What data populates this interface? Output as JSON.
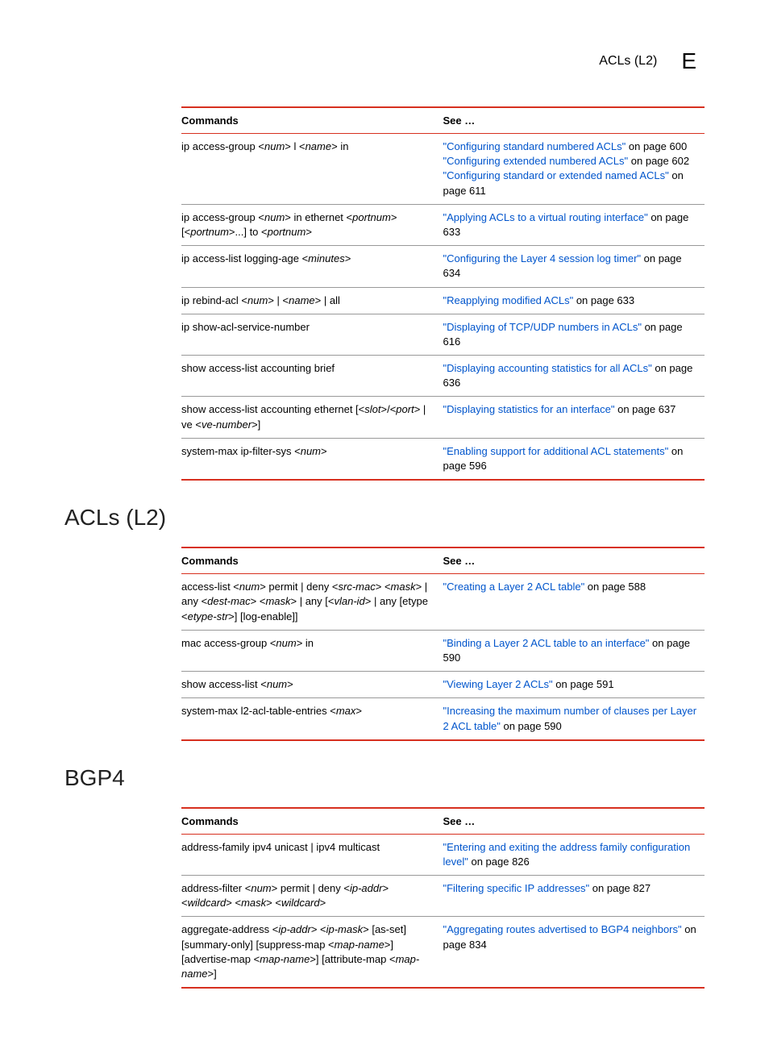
{
  "header": {
    "label": "ACLs (L2)",
    "letter": "E"
  },
  "table1": {
    "col1": "Commands",
    "col2": "See …",
    "rows": [
      {
        "cmd_parts": [
          "ip access-group <",
          "num",
          "> l <",
          "name",
          "> in"
        ],
        "see": [
          {
            "link": "\"Configuring standard numbered ACLs\"",
            "tail": " on page 600"
          },
          {
            "link": "\"Configuring extended numbered ACLs\"",
            "tail": " on page 602"
          },
          {
            "link": "\"Configuring standard or extended named ACLs\"",
            "tail": " on page 611"
          }
        ]
      },
      {
        "cmd_parts": [
          "ip access-group <",
          "num",
          "> in ethernet <",
          "portnum",
          "> [<",
          "portnum",
          ">...] to <",
          "portnum",
          ">"
        ],
        "see": [
          {
            "link": "\"Applying ACLs to a virtual routing interface\"",
            "tail": " on page 633"
          }
        ]
      },
      {
        "cmd_parts": [
          "ip access-list logging-age <",
          "minutes",
          ">"
        ],
        "see": [
          {
            "link": "\"Configuring the Layer 4 session log timer\"",
            "tail": " on page 634"
          }
        ]
      },
      {
        "cmd_parts": [
          "ip rebind-acl <",
          "num",
          "> | <",
          "name",
          "> | all"
        ],
        "see": [
          {
            "link": "\"Reapplying modified ACLs\"",
            "tail": " on page 633"
          }
        ]
      },
      {
        "cmd_parts": [
          "ip show-acl-service-number"
        ],
        "see": [
          {
            "link": "\"Displaying of TCP/UDP numbers in ACLs\"",
            "tail": " on page 616"
          }
        ]
      },
      {
        "cmd_parts": [
          "show access-list accounting brief"
        ],
        "see": [
          {
            "link": "\"Displaying accounting statistics for all ACLs\"",
            "tail": " on page 636"
          }
        ]
      },
      {
        "cmd_parts": [
          "show access-list accounting ethernet [<",
          "slot",
          ">/<",
          "port",
          "> | ve <",
          "ve-number",
          ">]"
        ],
        "see": [
          {
            "link": "\"Displaying statistics for an interface\"",
            "tail": " on page 637"
          }
        ]
      },
      {
        "cmd_parts": [
          "system-max ip-filter-sys <",
          "num",
          ">"
        ],
        "see": [
          {
            "link": "\"Enabling support for additional ACL statements\"",
            "tail": " on page 596"
          }
        ]
      }
    ]
  },
  "section2": {
    "heading": "ACLs (L2)",
    "col1": "Commands",
    "col2": "See …",
    "rows": [
      {
        "cmd_parts": [
          "access-list <",
          "num",
          "> permit | deny <",
          "src-mac",
          "> <",
          "mask",
          "> | any <",
          "dest-mac",
          "> <",
          "mask",
          "> | any [<",
          "vlan-id",
          "> | any [etype <",
          "etype-str",
          ">] [log-enable]]"
        ],
        "see": [
          {
            "link": "\"Creating a Layer 2 ACL table\"",
            "tail": " on page 588"
          }
        ]
      },
      {
        "cmd_parts": [
          "mac access-group <",
          "num",
          "> in"
        ],
        "see": [
          {
            "link": "\"Binding a Layer 2 ACL table to an interface\"",
            "tail": " on page 590"
          }
        ]
      },
      {
        "cmd_parts": [
          "show access-list <",
          "num",
          ">"
        ],
        "see": [
          {
            "link": "\"Viewing Layer 2 ACLs\"",
            "tail": " on page 591"
          }
        ]
      },
      {
        "cmd_parts": [
          "system-max l2-acl-table-entries <",
          "max",
          ">"
        ],
        "see": [
          {
            "link": "\"Increasing the maximum number of clauses per Layer 2 ACL table\"",
            "tail": " on page 590"
          }
        ]
      }
    ]
  },
  "section3": {
    "heading": "BGP4",
    "col1": "Commands",
    "col2": "See …",
    "rows": [
      {
        "cmd_parts": [
          "address-family ipv4 unicast | ipv4 multicast"
        ],
        "see": [
          {
            "link": "\"Entering and exiting the address family configuration level\"",
            "tail": " on page 826"
          }
        ]
      },
      {
        "cmd_parts": [
          "address-filter <",
          "num",
          "> permit | deny <",
          "ip-addr",
          "> <",
          "wildcard",
          "> <",
          "mask",
          "> <",
          "wildcard",
          ">"
        ],
        "see": [
          {
            "link": "\"Filtering specific IP addresses\"",
            "tail": " on page 827"
          }
        ]
      },
      {
        "cmd_parts": [
          "aggregate-address <",
          "ip-addr",
          "> <",
          "ip-mask",
          "> [as-set] [summary-only] [suppress-map <",
          "map-name",
          ">] [advertise-map <",
          "map-name",
          ">] [attribute-map <",
          "map-name",
          ">]"
        ],
        "see": [
          {
            "link": "\"Aggregating routes advertised to BGP4 neighbors\"",
            "tail": " on page 834"
          }
        ]
      }
    ]
  }
}
